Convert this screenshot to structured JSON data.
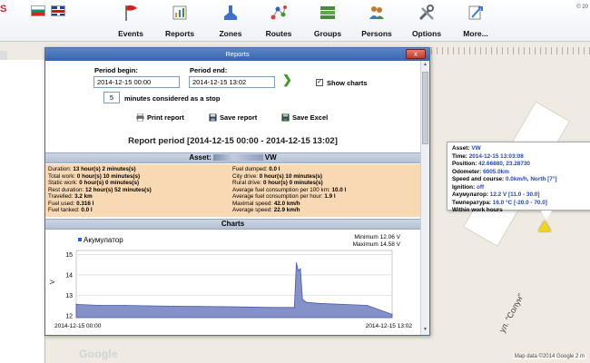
{
  "app": {
    "brand_letter": "S",
    "copyright": "© 20"
  },
  "languages": [
    {
      "code": "bg"
    },
    {
      "code": "en"
    }
  ],
  "nav": [
    {
      "label": "Events",
      "icon": "flag-icon",
      "color": "#d32020"
    },
    {
      "label": "Reports",
      "icon": "reports-icon",
      "color": "#e8912a"
    },
    {
      "label": "Zones",
      "icon": "zones-icon",
      "color": "#3f6fc9"
    },
    {
      "label": "Routes",
      "icon": "routes-icon",
      "color": "#d63f3f"
    },
    {
      "label": "Groups",
      "icon": "groups-icon",
      "color": "#4a8c3a"
    },
    {
      "label": "Persons",
      "icon": "persons-icon",
      "color": "#c47a2a"
    },
    {
      "label": "Options",
      "icon": "options-icon",
      "color": "#5b6470"
    },
    {
      "label": "More...",
      "icon": "more-icon",
      "color": "#3a78c8"
    }
  ],
  "dialog": {
    "title": "Reports",
    "close": "x",
    "period_begin_label": "Period begin:",
    "period_begin": "2014-12-15 00:00",
    "period_end_label": "Period end:",
    "period_end": "2014-12-15 13:02",
    "show_charts": "Show charts",
    "stop_minutes": "5",
    "stop_label": "minutes considered as a stop",
    "print": "Print report",
    "save": "Save report",
    "excel": "Save Excel",
    "report_period": "Report period [2014-12-15 00:00 - 2014-12-15 13:02]",
    "asset_prefix": "Asset:",
    "asset_suffix": "VW",
    "charts_header": "Charts"
  },
  "stats_left": [
    {
      "label": "Duration:",
      "value": "13 hour(s) 2 minutes(s)"
    },
    {
      "label": "Total work:",
      "value": "0 hour(s) 10 minutes(s)"
    },
    {
      "label": "Static work:",
      "value": "0 hour(s) 0 minutes(s)"
    },
    {
      "label": "Rest duration:",
      "value": "12 hour(s) 52 minutes(s)"
    },
    {
      "label": "Travelled:",
      "value": "3.2 km"
    },
    {
      "label": "Fuel used:",
      "value": "0.316 l"
    },
    {
      "label": "Fuel tanked:",
      "value": "0.0 l"
    }
  ],
  "stats_right": [
    {
      "label": "Fuel dumped:",
      "value": "0.0 l"
    },
    {
      "label": "City drive:",
      "value": "0 hour(s) 10 minutes(s)"
    },
    {
      "label": "Rural drive:",
      "value": "0 hour(s) 0 minutes(s)"
    },
    {
      "label": "Average fuel consumption per 100 km:",
      "value": "10.0 l"
    },
    {
      "label": "Average fuel consumption per hour:",
      "value": "1.9 l"
    },
    {
      "label": "Maximal speed:",
      "value": "42.0 km/h"
    },
    {
      "label": "Average speed:",
      "value": "22.9 km/h"
    }
  ],
  "chart_data": {
    "type": "area",
    "title": "",
    "series": [
      {
        "name": "Акумулатор",
        "x": [
          "2014-12-15 00:00",
          "2014-12-15 01:00",
          "2014-12-15 02:00",
          "2014-12-15 03:00",
          "2014-12-15 04:00",
          "2014-12-15 05:00",
          "2014-12-15 06:00",
          "2014-12-15 07:00",
          "2014-12-15 08:00",
          "2014-12-15 09:00",
          "2014-12-15 09:05",
          "2014-12-15 09:10",
          "2014-12-15 09:15",
          "2014-12-15 09:20",
          "2014-12-15 09:30",
          "2014-12-15 10:00",
          "2014-12-15 11:00",
          "2014-12-15 12:00",
          "2014-12-15 13:02"
        ],
        "values": [
          12.55,
          12.5,
          12.5,
          12.48,
          12.46,
          12.45,
          12.44,
          12.42,
          12.4,
          12.4,
          14.58,
          14.2,
          14.3,
          12.8,
          12.65,
          12.6,
          12.55,
          12.5,
          12.06
        ]
      }
    ],
    "minimum_label": "Minimum 12.06 V",
    "maximum_label": "Maximum 14.58 V",
    "ylabel": "V",
    "yticks": [
      12,
      13,
      14,
      15
    ],
    "ylim": [
      11.9,
      15.2
    ],
    "xtick_labels": [
      "2014-12-15 00:00",
      "2014-12-15 13:02"
    ],
    "color": "#6f7fc0",
    "grid": true
  },
  "info_popup": [
    {
      "label": "Asset:",
      "value": "VW"
    },
    {
      "label": "Time:",
      "value": "2014-12-15 13:03:08"
    },
    {
      "label": "Position:",
      "value": "42.66880, 23.28730"
    },
    {
      "label": "Odometer:",
      "value": "6005.0km"
    },
    {
      "label": "Speed and course:",
      "value": "0.0km/h, North [7°]"
    },
    {
      "label": "Ignition:",
      "value": "off"
    },
    {
      "label": "Акумулатор:",
      "value": "12.2 V [11.0 - 30.0]"
    },
    {
      "label": "Температура:",
      "value": "16.0 °C [-20.0 - 70.0]"
    },
    {
      "label": "Within work hours",
      "value": ""
    }
  ],
  "map": {
    "street": "ул. \"Солун\"",
    "google": "Google",
    "attribution": "Map data ©2014 Google   2 m"
  }
}
